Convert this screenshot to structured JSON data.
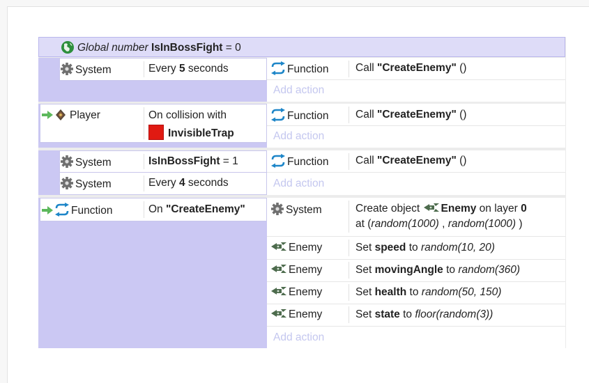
{
  "global": {
    "prefix": "Global number",
    "name": "IsInBossFight",
    "suffix": "= 0"
  },
  "add_action": "Add action",
  "events": {
    "e1": {
      "object": "System",
      "condition_pre": "Every",
      "condition_num": "5",
      "condition_post": "seconds",
      "action_object": "Function",
      "action_pre": "Call",
      "action_name": "\"CreateEnemy\"",
      "action_post": "()"
    },
    "e2": {
      "object": "Player",
      "condition_line1": "On collision with",
      "condition_target": "InvisibleTrap",
      "action_object": "Function",
      "action_pre": "Call",
      "action_name": "\"CreateEnemy\"",
      "action_post": "()"
    },
    "e3": {
      "c1_object": "System",
      "c1_var": "IsInBossFight",
      "c1_rest": "= 1",
      "c2_object": "System",
      "c2_pre": "Every",
      "c2_num": "4",
      "c2_post": "seconds",
      "action_object": "Function",
      "action_pre": "Call",
      "action_name": "\"CreateEnemy\"",
      "action_post": "()"
    },
    "e4": {
      "object": "Function",
      "condition_pre": "On",
      "condition_name": "\"CreateEnemy\"",
      "a1_object": "System",
      "a1_pre": "Create object",
      "a1_target": "Enemy",
      "a1_mid": "on layer",
      "a1_layer": "0",
      "a1_at": "at (",
      "a1_x": "random(1000)",
      "a1_comma": ",",
      "a1_y": "random(1000)",
      "a1_close": ")",
      "a2_object": "Enemy",
      "a2_pre": "Set",
      "a2_var": "speed",
      "a2_to": "to",
      "a2_val": "random(10, 20)",
      "a3_object": "Enemy",
      "a3_pre": "Set",
      "a3_var": "movingAngle",
      "a3_to": "to",
      "a3_val": "random(360)",
      "a4_object": "Enemy",
      "a4_pre": "Set",
      "a4_var": "health",
      "a4_to": "to",
      "a4_val": "random(50, 150)",
      "a5_object": "Enemy",
      "a5_pre": "Set",
      "a5_var": "state",
      "a5_to": "to",
      "a5_val": "floor(random(3))"
    }
  },
  "colors": {
    "lavender": "#cbc8f3",
    "add_action": "#c4c7ef",
    "trap_red": "#e01a12",
    "arrow_green": "#4caf50"
  }
}
